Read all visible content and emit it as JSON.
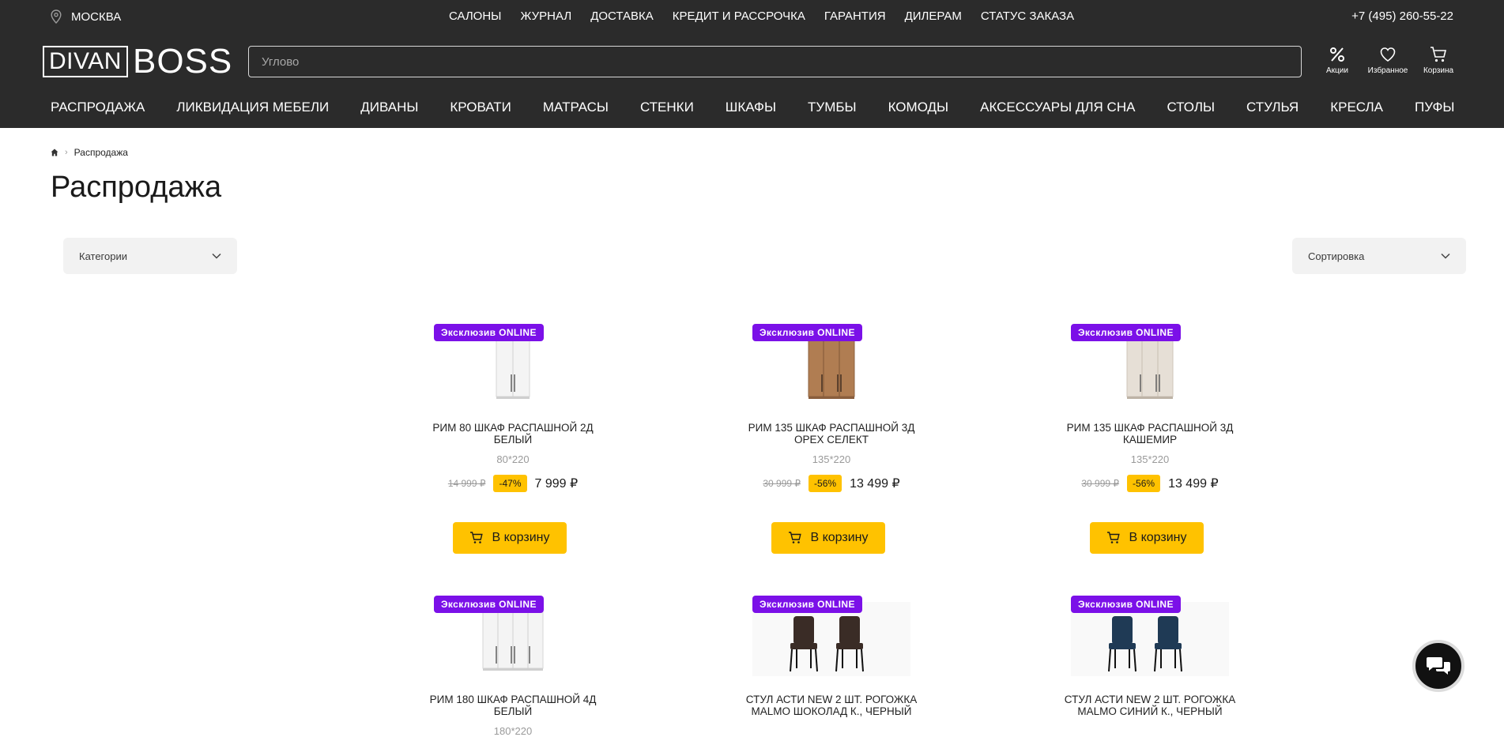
{
  "header": {
    "city": "МОСКВА",
    "top_links": [
      "САЛОНЫ",
      "ЖУРНАЛ",
      "ДОСТАВКА",
      "КРЕДИТ И РАССРОЧКА",
      "ГАРАНТИЯ",
      "ДИЛЕРАМ",
      "СТАТУС ЗАКАЗА"
    ],
    "phone": "+7 (495) 260-55-22",
    "logo": {
      "part1": "DIVAN",
      "part2": "BOSS"
    },
    "search_placeholder": "Углово",
    "icons": [
      {
        "label": "Акции",
        "icon": "percent-icon"
      },
      {
        "label": "Избранное",
        "icon": "heart-icon"
      },
      {
        "label": "Корзина",
        "icon": "cart-icon"
      }
    ],
    "main_nav": [
      "РАСПРОДАЖА",
      "ЛИКВИДАЦИЯ МЕБЕЛИ",
      "ДИВАНЫ",
      "КРОВАТИ",
      "МАТРАСЫ",
      "СТЕНКИ",
      "ШКАФЫ",
      "ТУМБЫ",
      "КОМОДЫ",
      "АКСЕССУАРЫ ДЛЯ СНА",
      "СТОЛЫ",
      "СТУЛЬЯ",
      "КРЕСЛА",
      "ПУФЫ"
    ]
  },
  "breadcrumb": {
    "current": "Распродажа"
  },
  "page_title": "Распродажа",
  "filters": {
    "categories": "Категории",
    "sort": "Сортировка"
  },
  "colors": {
    "header_bg": "#2b2b2b",
    "badge": "#7b10e8",
    "accent": "#ffc200"
  },
  "products": [
    {
      "badge": "Эксклюзив ONLINE",
      "name": "РИМ 80 ШКАФ РАСПАШНОЙ 2Д БЕЛЫЙ",
      "size": "80*220",
      "old_price": "14 999 ₽",
      "discount": "-47%",
      "price": "7 999 ₽",
      "button": "В корзину",
      "image": "wardrobe-white-2d"
    },
    {
      "badge": "Эксклюзив ONLINE",
      "name": "РИМ 135 ШКАФ РАСПАШНОЙ 3Д ОРЕХ СЕЛЕКТ",
      "size": "135*220",
      "old_price": "30 999 ₽",
      "discount": "-56%",
      "price": "13 499 ₽",
      "button": "В корзину",
      "image": "wardrobe-walnut-3d"
    },
    {
      "badge": "Эксклюзив ONLINE",
      "name": "РИМ 135 ШКАФ РАСПАШНОЙ 3Д КАШЕМИР",
      "size": "135*220",
      "old_price": "30 999 ₽",
      "discount": "-56%",
      "price": "13 499 ₽",
      "button": "В корзину",
      "image": "wardrobe-cashmere-3d"
    },
    {
      "badge": "Эксклюзив ONLINE",
      "name": "РИМ 180 ШКАФ РАСПАШНОЙ 4Д БЕЛЫЙ",
      "size": "180*220",
      "image": "wardrobe-white-4d"
    },
    {
      "badge": "Эксклюзив ONLINE",
      "name": "СТУЛ АСТИ NEW 2 ШТ. РОГОЖКА MALMO ШОКОЛАД К., ЧЕРНЫЙ",
      "image": "chairs-brown"
    },
    {
      "badge": "Эксклюзив ONLINE",
      "name": "СТУЛ АСТИ NEW 2 ШТ. РОГОЖКА MALMO СИНИЙ К., ЧЕРНЫЙ",
      "image": "chairs-blue"
    }
  ]
}
